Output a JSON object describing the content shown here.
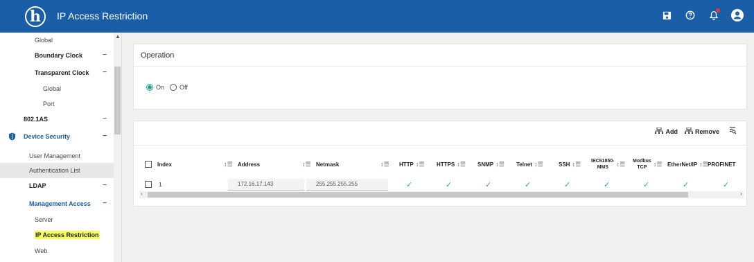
{
  "header": {
    "logo_glyph": "h",
    "title": "IP Access Restriction",
    "icons": [
      "save-icon",
      "help-icon",
      "notification-icon",
      "account-icon"
    ]
  },
  "sidebar": {
    "items": [
      {
        "label": "Global",
        "style": "plain"
      },
      {
        "label": "Boundary Clock",
        "style": "bold",
        "dash": "−"
      },
      {
        "label": "Transparent Clock",
        "style": "bold",
        "dash": "−"
      },
      {
        "label": "Global",
        "style": "plain"
      },
      {
        "label": "Port",
        "style": "plain"
      },
      {
        "label": "802.1AS",
        "style": "bold",
        "dash": "−"
      },
      {
        "label": "Device Security",
        "style": "blue",
        "dash": "−"
      },
      {
        "label": "User Management",
        "style": "plain"
      },
      {
        "label": "Authentication List",
        "style": "active"
      },
      {
        "label": "LDAP",
        "style": "bold",
        "dash": "−"
      },
      {
        "label": "Management Access",
        "style": "blue",
        "dash": "−"
      },
      {
        "label": "Server",
        "style": "plain"
      },
      {
        "label": "IP Access Restriction",
        "style": "highlight"
      },
      {
        "label": "Web",
        "style": "plain"
      }
    ]
  },
  "operation": {
    "title": "Operation",
    "on_label": "On",
    "off_label": "Off",
    "selected": "On"
  },
  "toolbar": {
    "add_label": "Add",
    "remove_label": "Remove"
  },
  "table": {
    "columns": {
      "index": "Index",
      "address": "Address",
      "netmask": "Netmask",
      "http": "HTTP",
      "https": "HTTPS",
      "snmp": "SNMP",
      "telnet": "Telnet",
      "ssh": "SSH",
      "iec_1": "IEC61850-",
      "iec_2": "MMS",
      "modbus_1": "Modbus",
      "modbus_2": "TCP",
      "ethernetip": "EtherNet/IP",
      "profinet": "PROFINET"
    },
    "rows": [
      {
        "index": "1",
        "address": "172.16.17.143",
        "netmask": "255.255.255.255",
        "check": "✓"
      }
    ]
  },
  "colors": {
    "header_bg": "#1b5ea8",
    "accent_teal": "#26a69a",
    "highlight": "#f6ff5a"
  }
}
